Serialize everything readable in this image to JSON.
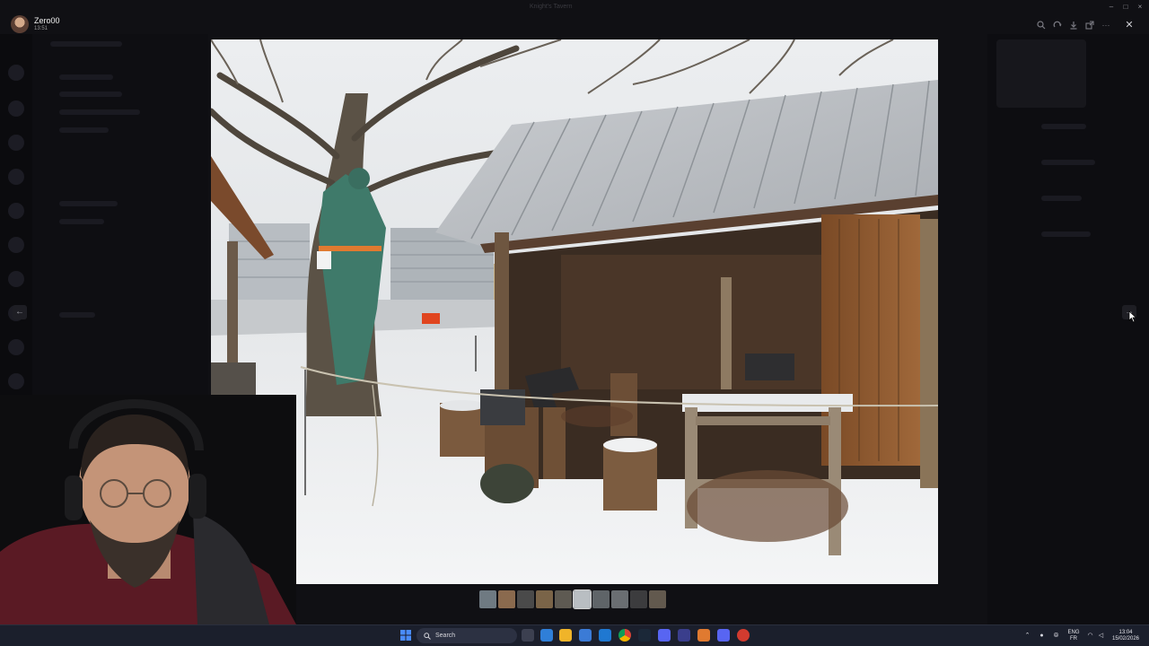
{
  "viewer": {
    "user_name": "Zero00",
    "timestamp": "13:51",
    "window_title": "Knight's Tavern",
    "banner_text": "",
    "toolbar_icons": [
      "zoom-icon",
      "rotate-icon",
      "download-icon",
      "open-external-icon",
      "more-icon"
    ],
    "close_icon": "close-icon",
    "prev_icon": "arrow-left-icon",
    "next_icon": "arrow-right-icon",
    "thumbnails_count": 10,
    "active_thumbnail": 6
  },
  "taskbar": {
    "search_label": "Search",
    "lang_top": "ENG",
    "lang_bottom": "FR",
    "clock_time": "13:04",
    "clock_date": "15/02/2026",
    "colors": {
      "accent": "#4a8cff"
    }
  }
}
